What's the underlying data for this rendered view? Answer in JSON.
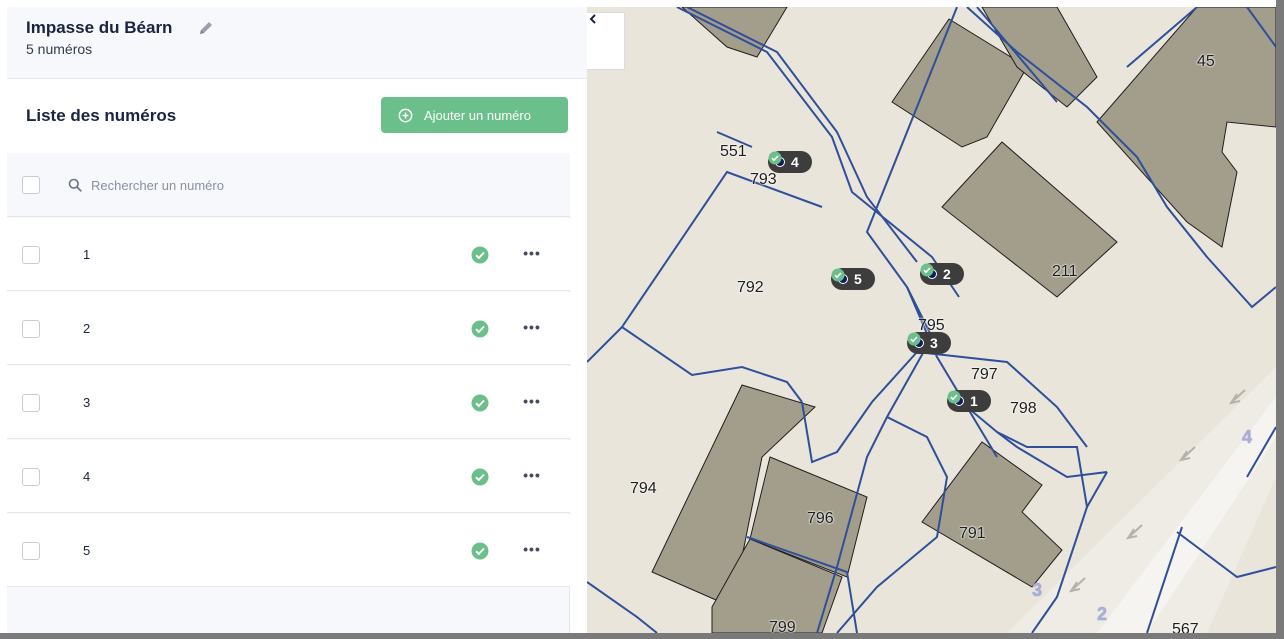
{
  "street": {
    "name": "Impasse du Béarn",
    "count_label": "5 numéros"
  },
  "list": {
    "title": "Liste des numéros",
    "add_button_label": "Ajouter un numéro",
    "search_placeholder": "Rechercher un numéro",
    "rows": [
      {
        "numero": "1",
        "certified": true,
        "menu": "•••"
      },
      {
        "numero": "2",
        "certified": true,
        "menu": "•••"
      },
      {
        "numero": "3",
        "certified": true,
        "menu": "•••"
      },
      {
        "numero": "4",
        "certified": true,
        "menu": "•••"
      },
      {
        "numero": "5",
        "certified": true,
        "menu": "•••"
      }
    ]
  },
  "map": {
    "collapse_icon": "chevron-left-icon",
    "parcel_labels": [
      "45",
      "551",
      "793",
      "211",
      "792",
      "795",
      "797",
      "798",
      "794",
      "796",
      "791",
      "799",
      "567"
    ],
    "road_numbers": [
      "4",
      "3",
      "2"
    ],
    "markers": [
      {
        "numero": "4"
      },
      {
        "numero": "5"
      },
      {
        "numero": "2"
      },
      {
        "numero": "3"
      },
      {
        "numero": "1"
      }
    ]
  },
  "colors": {
    "accent_green": "#6bbf8a",
    "title_navy": "#1a2340",
    "map_bg": "#e9e5db",
    "building": "#a39e8c",
    "parcel_line": "#2f4f9a",
    "marker_bg": "#3d3d3d"
  }
}
